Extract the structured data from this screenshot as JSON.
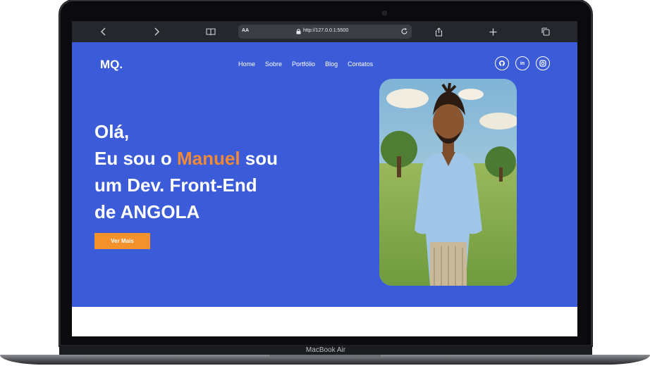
{
  "device": {
    "brand_label": "MacBook Air"
  },
  "browser": {
    "reader_label": "AA",
    "url": "http://127.0.0.1:5500",
    "icons": [
      "chevron-left-icon",
      "chevron-right-icon",
      "book-icon",
      "lock-icon",
      "reload-icon",
      "share-icon",
      "plus-icon",
      "tabs-icon"
    ]
  },
  "site": {
    "logo": "MQ.",
    "nav": [
      "Home",
      "Sobre",
      "Portfólio",
      "Blog",
      "Contatos"
    ],
    "socials": [
      {
        "icon": "github-icon"
      },
      {
        "icon": "linkedin-icon",
        "text": "in"
      },
      {
        "icon": "instagram-icon"
      }
    ],
    "hero": {
      "line1": "Olá,",
      "line2_prefix": "Eu sou o ",
      "name": "Manuel",
      "line2_suffix": " sou",
      "line3": "um Dev. Front-End",
      "line4": "de ANGOLA"
    },
    "cta_label": "Ver Mais",
    "colors": {
      "background": "#3b5bd8",
      "accent": "#f28a35",
      "button": "#f3922c"
    }
  }
}
